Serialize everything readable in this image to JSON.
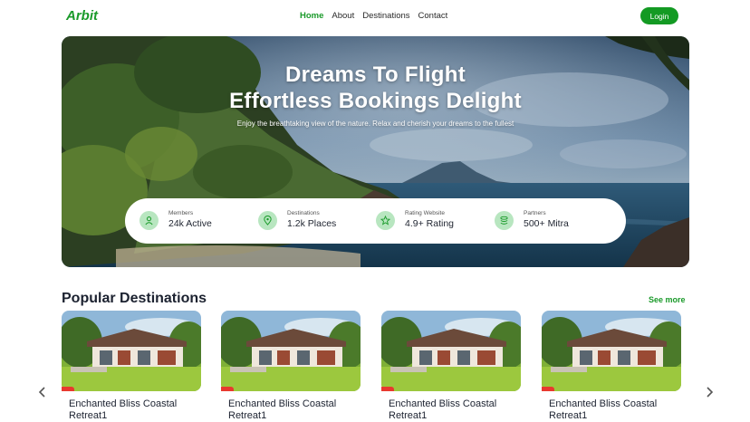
{
  "nav": {
    "logo": "Arbit",
    "links": [
      "Home",
      "About",
      "Destinations",
      "Contact"
    ],
    "active_link": "Home",
    "login_label": "Login"
  },
  "hero": {
    "title_line1": "Dreams To Flight",
    "title_line2": "Effortless Bookings Delight",
    "subtitle": "Enjoy the breathtaking view of the nature. Relax and cherish your dreams to the fullest",
    "stats": [
      {
        "label": "Members",
        "value": "24k Active",
        "icon": "user-icon"
      },
      {
        "label": "Destinations",
        "value": "1.2k Places",
        "icon": "location-pin-icon"
      },
      {
        "label": "Rating Website",
        "value": "4.9+ Rating",
        "icon": "star-icon"
      },
      {
        "label": "Partners",
        "value": "500+ Mitra",
        "icon": "layers-icon"
      }
    ]
  },
  "destinations": {
    "title": "Popular Destinations",
    "see_more": "See more",
    "cards": [
      {
        "name": "Enchanted Bliss Coastal Retreat1"
      },
      {
        "name": "Enchanted Bliss Coastal Retreat1"
      },
      {
        "name": "Enchanted Bliss Coastal Retreat1"
      },
      {
        "name": "Enchanted Bliss Coastal Retreat1"
      }
    ]
  },
  "colors": {
    "brand_green": "#139a23",
    "icon_bg": "#b8e6c0",
    "tag_red": "#e8392f"
  }
}
